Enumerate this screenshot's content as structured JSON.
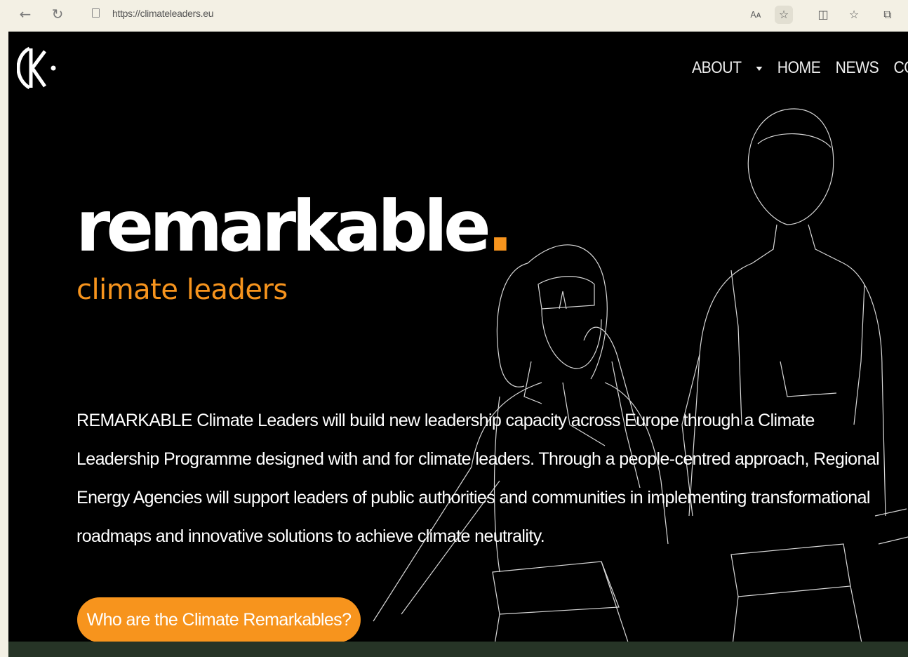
{
  "browser": {
    "url": "https://climateleaders.eu",
    "back_icon": "arrow-left",
    "reload_icon": "reload",
    "read_aloud_label": "Aᴀ",
    "favorite_icon": "star",
    "split_icon": "split-screen",
    "favorites_icon": "favorites-list",
    "collections_icon": "collections"
  },
  "nav": {
    "items": [
      "ABOUT",
      "HOME",
      "NEWS",
      "CONT"
    ]
  },
  "hero": {
    "brand": "remarkable",
    "brand_dot": ".",
    "subtitle": "climate leaders",
    "description": "REMARKABLE Climate Leaders will build new leadership capacity across Europe through a Climate Leadership Programme designed with and for climate leaders. Through a people-centred approach, Regional Energy Agencies will support leaders of public authorities and communities in implementing transformational roadmaps and innovative solutions to achieve climate neutrality.",
    "cta": "Who are the Climate Remarkables?"
  },
  "colors": {
    "accent": "#f7941d",
    "page_bg": "#000000",
    "footer_strip": "#263426"
  }
}
